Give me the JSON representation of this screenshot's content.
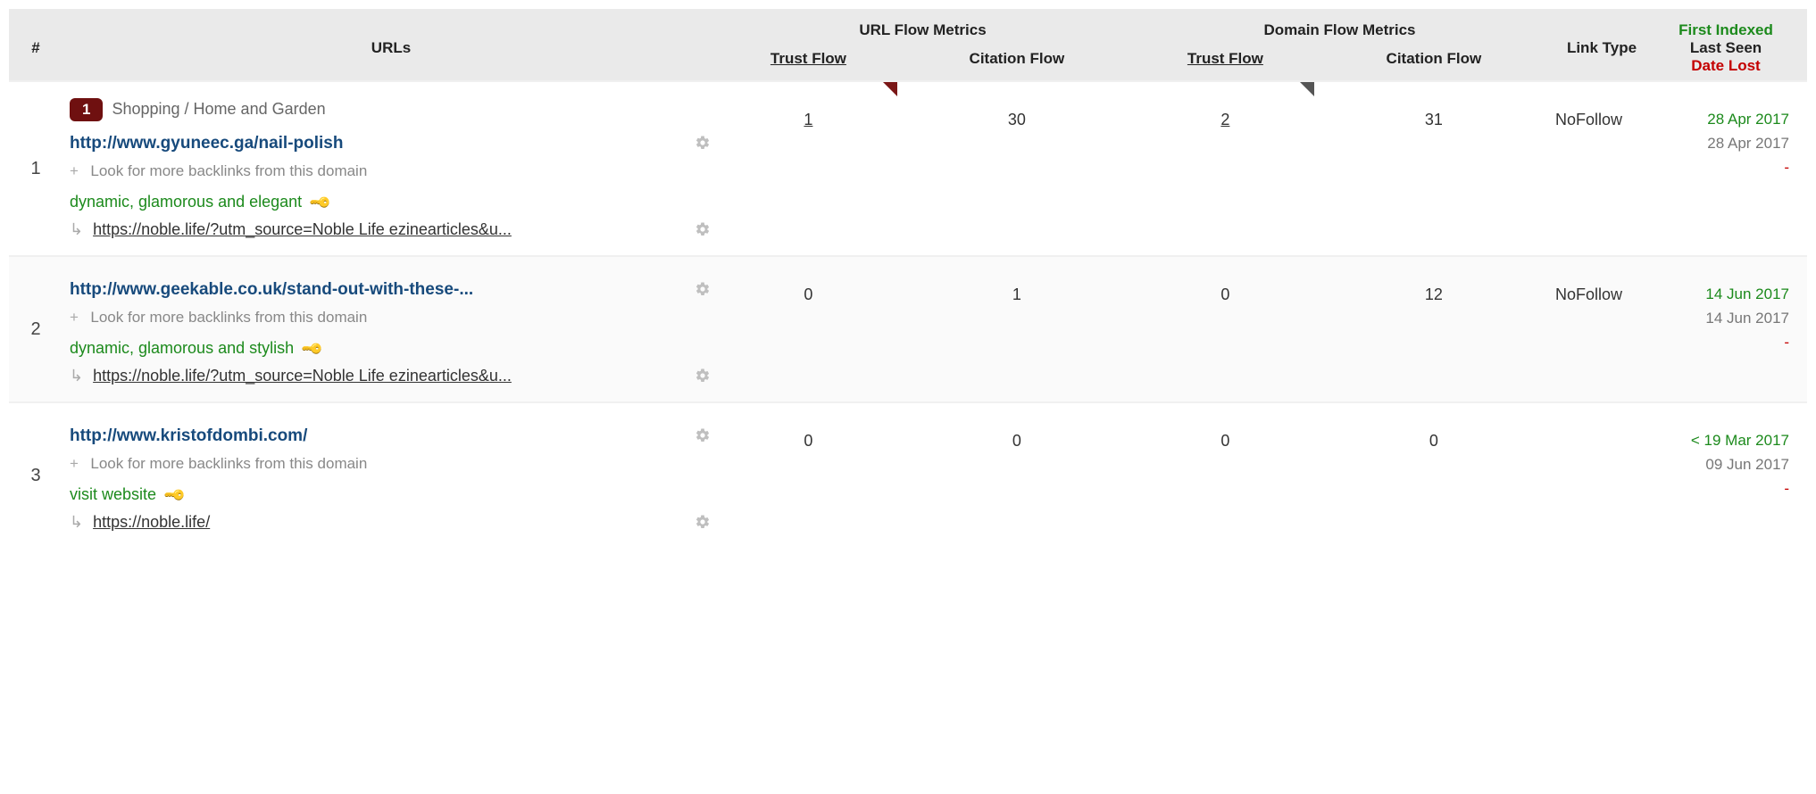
{
  "head": {
    "idx": "#",
    "urls": "URLs",
    "url_grp": "URL Flow Metrics",
    "dom_grp": "Domain Flow Metrics",
    "tf": "Trust Flow",
    "cf": "Citation Flow",
    "link_type": "Link Type",
    "first_idx": "First Indexed",
    "last_seen": "Last Seen",
    "date_lost": "Date Lost"
  },
  "labels": {
    "more_backlinks": "Look for more backlinks from this domain",
    "plus": "+"
  },
  "rows": [
    {
      "n": "1",
      "badge": "1",
      "category": "Shopping / Home and Garden",
      "src": "http://www.gyuneec.ga/nail-polish",
      "anchor": "dynamic, glamorous and elegant",
      "target": "https://noble.life/?utm_source=Noble Life ezinearticles&u...",
      "u_tf": "1",
      "u_cf": "30",
      "d_tf": "2",
      "d_cf": "31",
      "flag_u": true,
      "flag_d": true,
      "u_tf_link": true,
      "d_tf_link": true,
      "link_type": "NoFollow",
      "first": "28 Apr 2017",
      "last": "28 Apr 2017",
      "lost": "-"
    },
    {
      "n": "2",
      "src": "http://www.geekable.co.uk/stand-out-with-these-...",
      "anchor": "dynamic, glamorous and stylish",
      "target": "https://noble.life/?utm_source=Noble Life ezinearticles&u...",
      "u_tf": "0",
      "u_cf": "1",
      "d_tf": "0",
      "d_cf": "12",
      "link_type": "NoFollow",
      "first": "14 Jun 2017",
      "last": "14 Jun 2017",
      "lost": "-"
    },
    {
      "n": "3",
      "src": "http://www.kristofdombi.com/",
      "anchor": "visit website",
      "target": "https://noble.life/",
      "u_tf": "0",
      "u_cf": "0",
      "d_tf": "0",
      "d_cf": "0",
      "link_type": "",
      "first": "< 19 Mar 2017",
      "last": "09 Jun 2017",
      "lost": "-"
    }
  ]
}
